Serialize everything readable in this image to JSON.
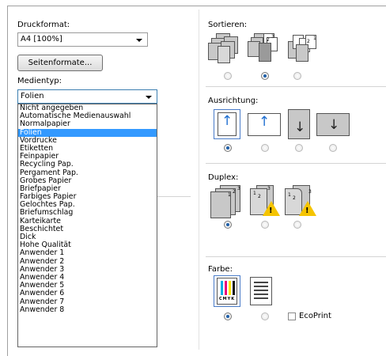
{
  "left": {
    "druckformat_label": "Druckformat:",
    "druckformat_value": "A4  [100%]",
    "seitenformate_button": "Seitenformate...",
    "medientyp_label": "Medientyp:",
    "medientyp_value": "Folien",
    "medientyp_options": [
      "Nicht angegeben",
      "Automatische Medienauswahl",
      "Normalpapier",
      "Folien",
      "Vordrucke",
      "Etiketten",
      "Feinpapier",
      "Recycling Pap.",
      "Pergament Pap.",
      "Grobes Papier",
      "Briefpapier",
      "Farbiges Papier",
      "Gelochtes Pap.",
      "Briefumschlag",
      "Karteikarte",
      "Beschichtet",
      "Dick",
      "Hohe Qualität",
      "Anwender 1",
      "Anwender 2",
      "Anwender 3",
      "Anwender 4",
      "Anwender 5",
      "Anwender 6",
      "Anwender 7",
      "Anwender 8"
    ],
    "selected_option": "Folien"
  },
  "right": {
    "sortieren_label": "Sortieren:",
    "ausrichtung_label": "Ausrichtung:",
    "duplex_label": "Duplex:",
    "farbe_label": "Farbe:",
    "cmyk_text": "CMYK",
    "ecoprint_label": "EcoPrint",
    "ecoprint_checked": false,
    "sortieren_selected": 1,
    "ausrichtung_selected": 0,
    "duplex_selected": 0,
    "farbe_selected": 0
  },
  "icons": {
    "arrow_up": "↑",
    "arrow_down": "↓",
    "warning": "!"
  },
  "colors": {
    "selection": "#3399ff",
    "focus_border": "#3c7fb1",
    "arrow_blue": "#1f6fd1",
    "warning_yellow": "#f5c400"
  }
}
